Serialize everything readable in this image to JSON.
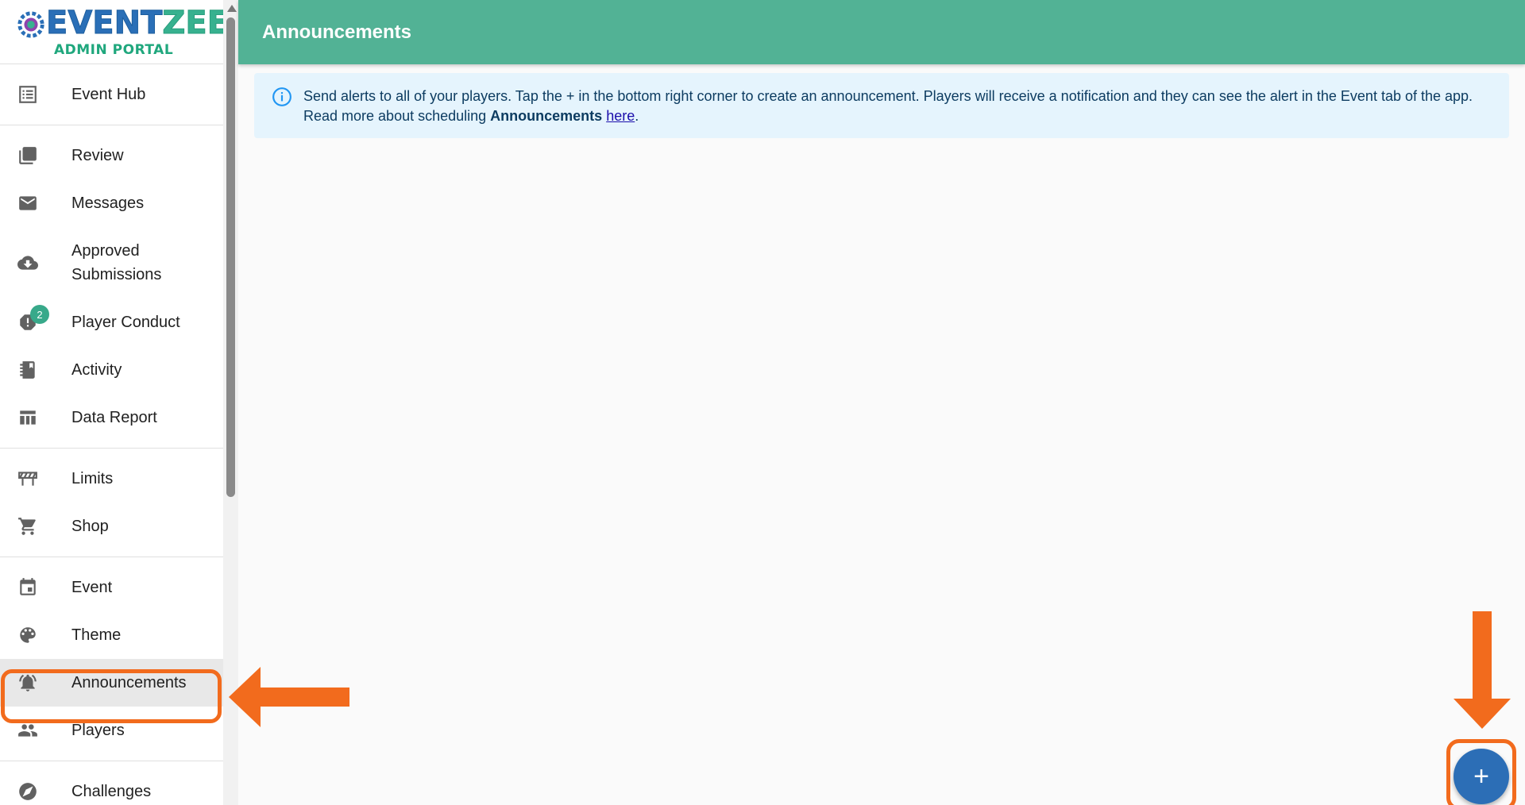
{
  "logo": {
    "word_main": "EVENT",
    "word_accent": "ZEE",
    "subtitle": "ADMIN PORTAL"
  },
  "sidebar": {
    "sections": [
      {
        "items": [
          {
            "label": "Event Hub",
            "icon": "list-icon"
          }
        ]
      },
      {
        "items": [
          {
            "label": "Review",
            "icon": "photo-library-icon"
          },
          {
            "label": "Messages",
            "icon": "mail-icon"
          },
          {
            "label": "Approved Submissions",
            "icon": "cloud-download-icon"
          },
          {
            "label": "Player Conduct",
            "icon": "report-icon",
            "badge": "2"
          },
          {
            "label": "Activity",
            "icon": "notebook-icon"
          },
          {
            "label": "Data Report",
            "icon": "table-icon"
          }
        ]
      },
      {
        "items": [
          {
            "label": "Limits",
            "icon": "barrier-icon"
          },
          {
            "label": "Shop",
            "icon": "cart-icon"
          }
        ]
      },
      {
        "items": [
          {
            "label": "Event",
            "icon": "calendar-icon"
          },
          {
            "label": "Theme",
            "icon": "palette-icon"
          },
          {
            "label": "Announcements",
            "icon": "bell-icon",
            "active": true
          },
          {
            "label": "Players",
            "icon": "people-icon"
          }
        ]
      },
      {
        "items": [
          {
            "label": "Challenges",
            "icon": "explore-icon"
          }
        ]
      }
    ]
  },
  "header": {
    "title": "Announcements"
  },
  "alert": {
    "text_1": "Send alerts to all of your players. Tap the + in the bottom right corner to create an announcement. Players will receive a notification and they can see the alert in the Event tab of the app.",
    "text_2": "Read more about scheduling ",
    "bold": "Announcements",
    "link": "here",
    "end": "."
  },
  "fab": {
    "label": "+"
  },
  "colors": {
    "header": "#52b295",
    "fab": "#2c6eb6",
    "highlight": "#f26b1d",
    "alert_bg": "#e5f4fd"
  }
}
